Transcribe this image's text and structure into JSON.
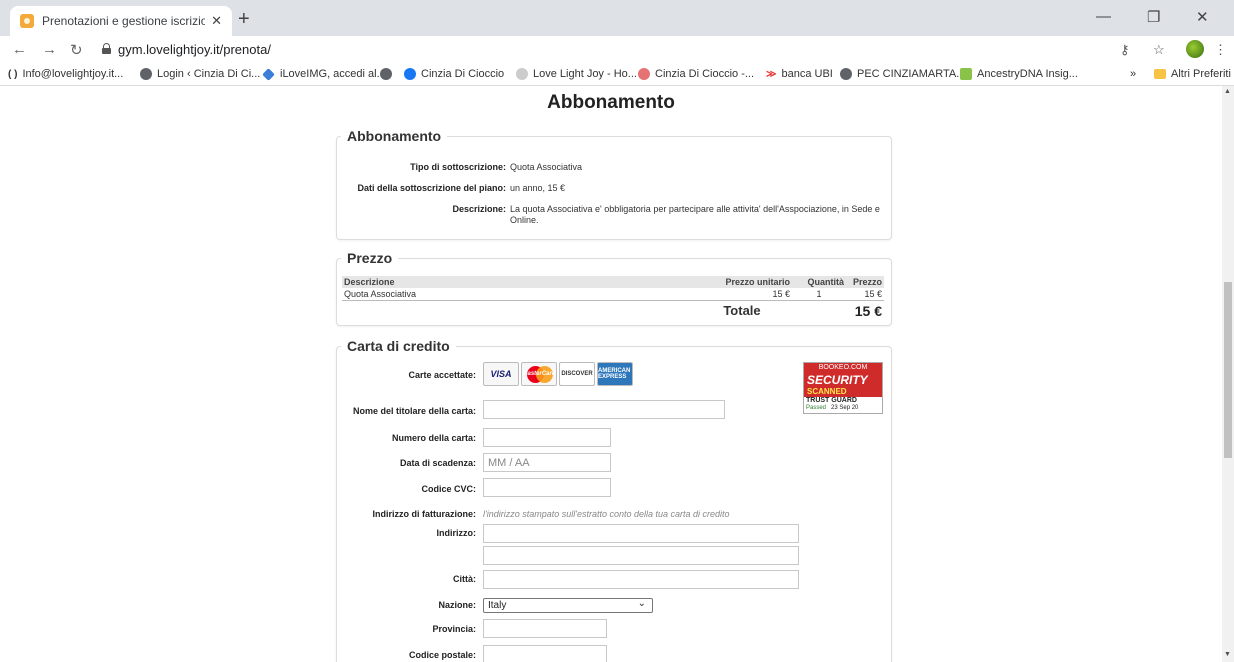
{
  "browser": {
    "tab_title": "Prenotazioni e gestione iscrizioni",
    "tab_close": "✕",
    "new_tab": "+",
    "url": "gym.lovelightjoy.it/prenota/",
    "bookmarks": [
      "Info@lovelightjoy.it...",
      "Login ‹ Cinzia Di Ci...",
      "iLoveIMG, accedi al...",
      "Cinzia Di Cioccio",
      "Love Light Joy - Ho...",
      "Cinzia Di Cioccio -...",
      "banca UBI",
      "PEC CINZIAMARTA...",
      "AncestryDNA Insig..."
    ],
    "other_bookmarks": "Altri Preferiti",
    "accent_color": "#f4a93b"
  },
  "page": {
    "title": "Abbonamento",
    "subscription": {
      "legend": "Abbonamento",
      "rows": [
        {
          "label": "Tipo di sottoscrizione:",
          "value": "Quota Associativa"
        },
        {
          "label": "Dati della sottoscrizione del piano:",
          "value": "un anno, 15 €"
        },
        {
          "label": "Descrizione:",
          "value": "La quota Associativa e' obbligatoria per partecipare alle attivita' dell'Asspociazione, in Sede e Online."
        }
      ]
    },
    "price": {
      "legend": "Prezzo",
      "headers": [
        "Descrizione",
        "Prezzo unitario",
        "Quantità",
        "Prezzo"
      ],
      "rows": [
        {
          "description": "Quota Associativa",
          "unit_price": "15 €",
          "quantity": "1",
          "price": "15 €"
        }
      ],
      "total_label": "Totale",
      "total_value": "15 €"
    },
    "credit_card": {
      "legend": "Carta di credito",
      "accepted_label": "Carte accettate:",
      "cards": [
        "VISA",
        "MasterCard",
        "DISCOVER",
        "AMERICAN EXPRESS"
      ],
      "badge": {
        "line1": "BOOKEO.COM",
        "line2": "SECURITY",
        "line3": "SCANNED",
        "line4": "TRUST GUARD",
        "line5_passed": "Passed",
        "line5_date": "23 Sep 20"
      },
      "holder_label": "Nome del titolare della carta:",
      "number_label": "Numero della carta:",
      "expiry_label": "Data di scadenza:",
      "expiry_placeholder": "MM / AA",
      "cvc_label": "Codice CVC:",
      "billing_label": "Indirizzo di fatturazione:",
      "billing_hint": "l'indirizzo stampato sull'estratto conto della tua carta di credito",
      "address_label": "Indirizzo:",
      "city_label": "Città:",
      "country_label": "Nazione:",
      "country_value": "Italy",
      "province_label": "Provincia:",
      "postal_label": "Codice postale:"
    }
  }
}
